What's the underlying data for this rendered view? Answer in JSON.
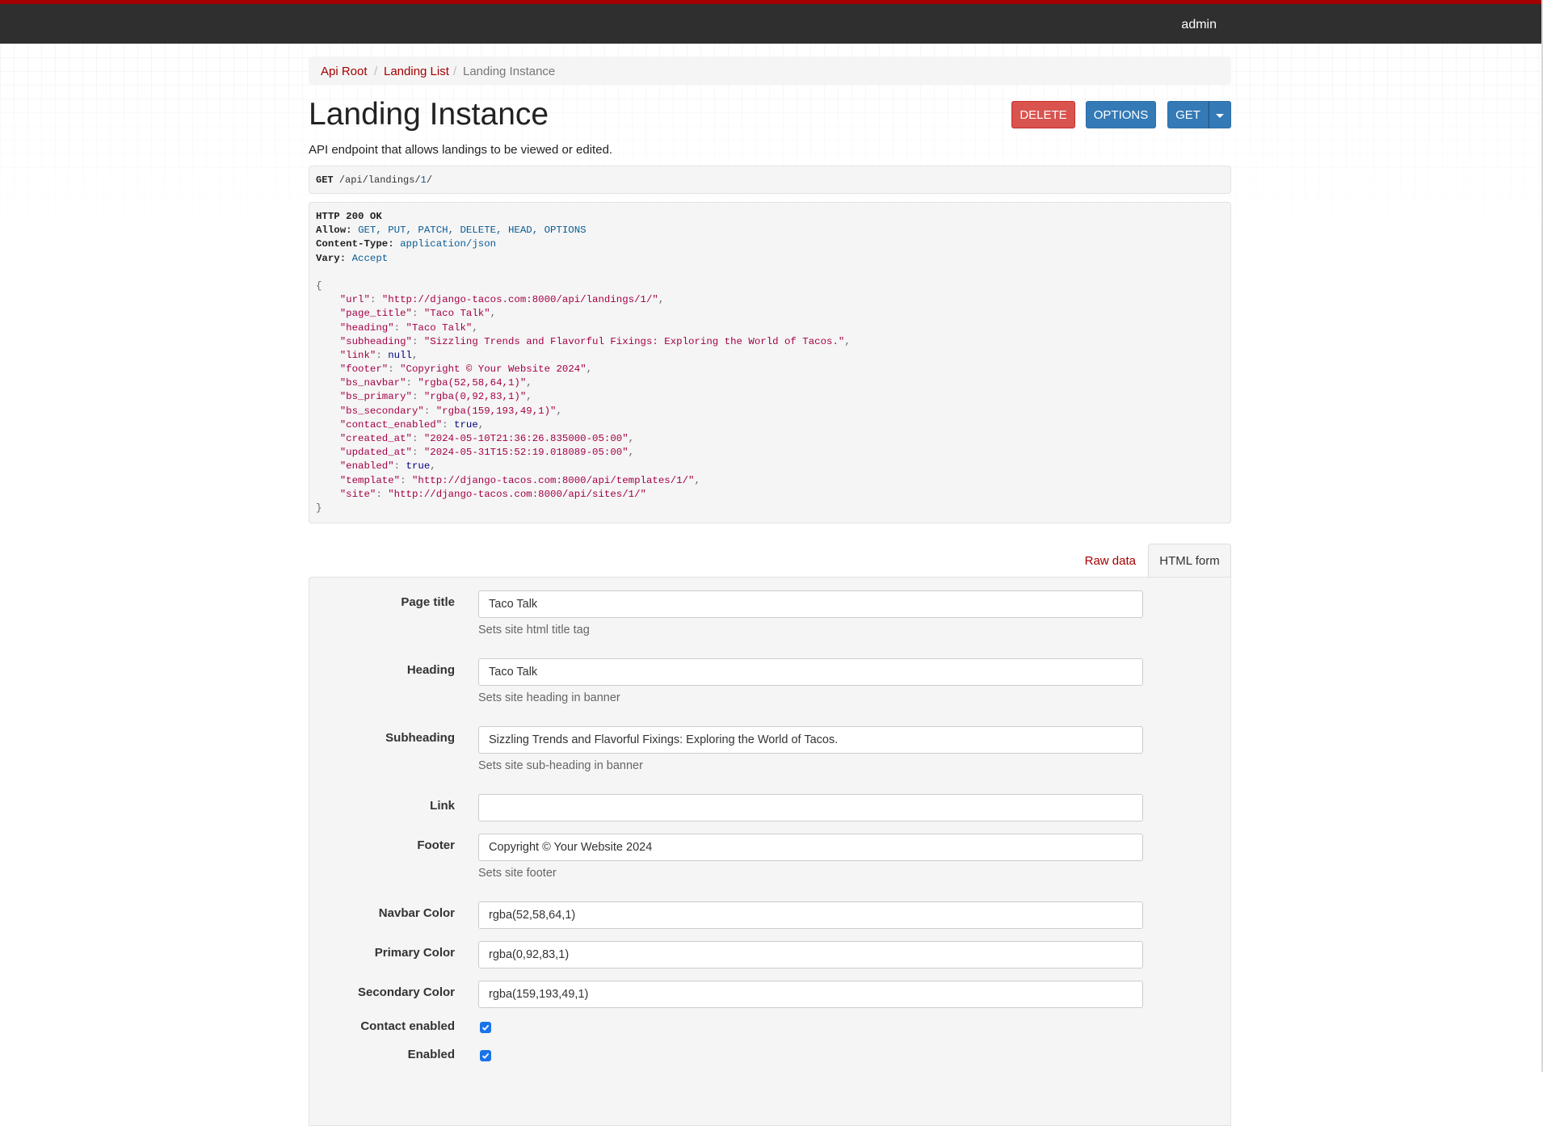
{
  "navbar": {
    "user": "admin",
    "accent_color": "#a30000",
    "bg_color": "#2f2f2f"
  },
  "breadcrumb": [
    {
      "label": "Api Root"
    },
    {
      "label": "Landing List"
    },
    {
      "label": "Landing Instance"
    }
  ],
  "page": {
    "title": "Landing Instance",
    "description": "API endpoint that allows landings to be viewed or edited."
  },
  "buttons": {
    "delete": "DELETE",
    "options": "OPTIONS",
    "get": "GET",
    "caret_icon": "caret-down"
  },
  "request": {
    "method": "GET",
    "path_prefix": " /api/landings/",
    "path_id": "1",
    "path_suffix": "/"
  },
  "response": {
    "status": "HTTP 200 OK",
    "headers": [
      {
        "name": "Allow:",
        "value": "GET, PUT, PATCH, DELETE, HEAD, OPTIONS"
      },
      {
        "name": "Content-Type:",
        "value": "application/json"
      },
      {
        "name": "Vary:",
        "value": "Accept"
      }
    ],
    "open_brace": "{",
    "close_brace": "}",
    "body": [
      {
        "key": "\"url\"",
        "value": "\"http://django-tacos.com:8000/api/landings/1/\"",
        "comma": ","
      },
      {
        "key": "\"page_title\"",
        "value": "\"Taco Talk\"",
        "comma": ","
      },
      {
        "key": "\"heading\"",
        "value": "\"Taco Talk\"",
        "comma": ","
      },
      {
        "key": "\"subheading\"",
        "value": "\"Sizzling Trends and Flavorful Fixings: Exploring the World of Tacos.\"",
        "comma": ","
      },
      {
        "key": "\"link\"",
        "value": "null",
        "comma": ","
      },
      {
        "key": "\"footer\"",
        "value": "\"Copyright © Your Website 2024\"",
        "comma": ","
      },
      {
        "key": "\"bs_navbar\"",
        "value": "\"rgba(52,58,64,1)\"",
        "comma": ","
      },
      {
        "key": "\"bs_primary\"",
        "value": "\"rgba(0,92,83,1)\"",
        "comma": ","
      },
      {
        "key": "\"bs_secondary\"",
        "value": "\"rgba(159,193,49,1)\"",
        "comma": ","
      },
      {
        "key": "\"contact_enabled\"",
        "value": "true",
        "comma": ","
      },
      {
        "key": "\"created_at\"",
        "value": "\"2024-05-10T21:36:26.835000-05:00\"",
        "comma": ","
      },
      {
        "key": "\"updated_at\"",
        "value": "\"2024-05-31T15:52:19.018089-05:00\"",
        "comma": ","
      },
      {
        "key": "\"enabled\"",
        "value": "true",
        "comma": ","
      },
      {
        "key": "\"template\"",
        "value": "\"http://django-tacos.com:8000/api/templates/1/\"",
        "comma": ","
      },
      {
        "key": "\"site\"",
        "value": "\"http://django-tacos.com:8000/api/sites/1/\"",
        "comma": ""
      }
    ]
  },
  "tabs": {
    "raw": "Raw data",
    "html": "HTML form"
  },
  "form": {
    "page_title": {
      "label": "Page title",
      "value": "Taco Talk",
      "help": "Sets site html title tag"
    },
    "heading": {
      "label": "Heading",
      "value": "Taco Talk",
      "help": "Sets site heading in banner"
    },
    "subheading": {
      "label": "Subheading",
      "value": "Sizzling Trends and Flavorful Fixings: Exploring the World of Tacos.",
      "help": "Sets site sub-heading in banner"
    },
    "link": {
      "label": "Link",
      "value": ""
    },
    "footer": {
      "label": "Footer",
      "value": "Copyright © Your Website 2024",
      "help": "Sets site footer"
    },
    "navbar_color": {
      "label": "Navbar Color",
      "value": "rgba(52,58,64,1)"
    },
    "primary_color": {
      "label": "Primary Color",
      "value": "rgba(0,92,83,1)"
    },
    "secondary_color": {
      "label": "Secondary Color",
      "value": "rgba(159,193,49,1)"
    },
    "contact_enabled": {
      "label": "Contact enabled",
      "checked": true
    },
    "enabled": {
      "label": "Enabled",
      "checked": true
    }
  }
}
